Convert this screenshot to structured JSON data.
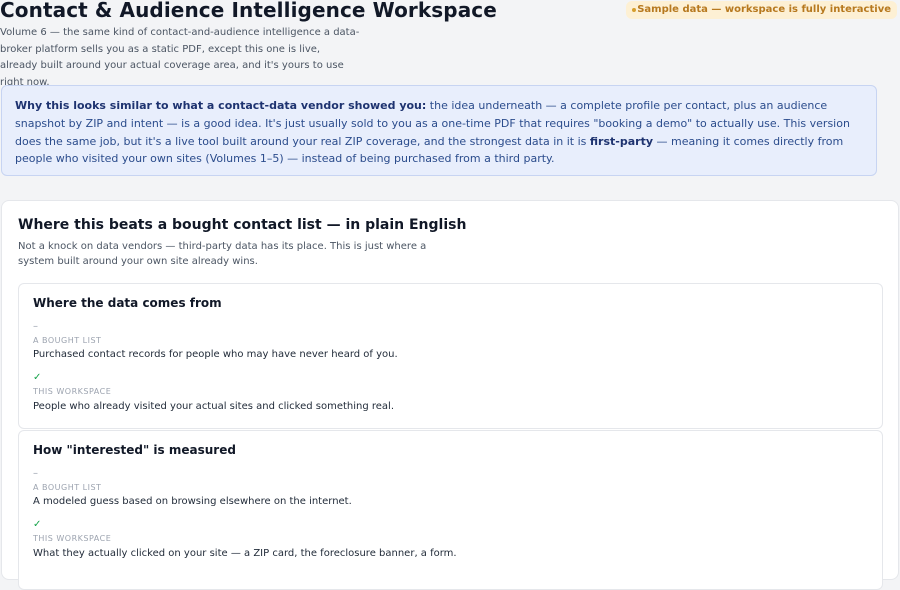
{
  "header": {
    "title": "Contact & Audience Intelligence Workspace",
    "subtitle": "Volume 6 — the same kind of contact-and-audience intelligence a data-broker platform sells you as a static PDF, except this one is live, already built around your actual coverage area, and it's yours to use right now.",
    "badge": "Sample data — workspace is fully interactive"
  },
  "notice": {
    "lead": "Why this looks similar to what a contact-data vendor showed you:",
    "text1": " the idea underneath — a complete profile per contact, plus an audience snapshot by ZIP and intent — is a good idea. It's just usually sold to you as a one-time PDF that requires \"booking a demo\" to actually use. This version does the same job, but it's a live tool built around your real ZIP coverage, and the strongest data in it is ",
    "emphasis": "first-party",
    "text2": " — meaning it comes directly from people who visited your own sites (Volumes 1–5) — instead of being purchased from a third party."
  },
  "comparison": {
    "title": "Where this beats a bought contact list — in plain English",
    "description": "Not a knock on data vendors — third-party data has its place. This is just where a system built around your own site already wins.",
    "rows": [
      {
        "title": "Where the data comes from",
        "bought_mark": "–",
        "bought_label": "A BOUGHT LIST",
        "bought_text": "Purchased contact records for people who may have never heard of you.",
        "ours_mark": "✓",
        "ours_label": "THIS WORKSPACE",
        "ours_text": "People who already visited your actual sites and clicked something real."
      },
      {
        "title": "How \"interested\" is measured",
        "bought_mark": "–",
        "bought_label": "A BOUGHT LIST",
        "bought_text": "A modeled guess based on browsing elsewhere on the internet.",
        "ours_mark": "✓",
        "ours_label": "THIS WORKSPACE",
        "ours_text": "What they actually clicked on your site — a ZIP card, the foreclosure banner, a form."
      }
    ]
  }
}
